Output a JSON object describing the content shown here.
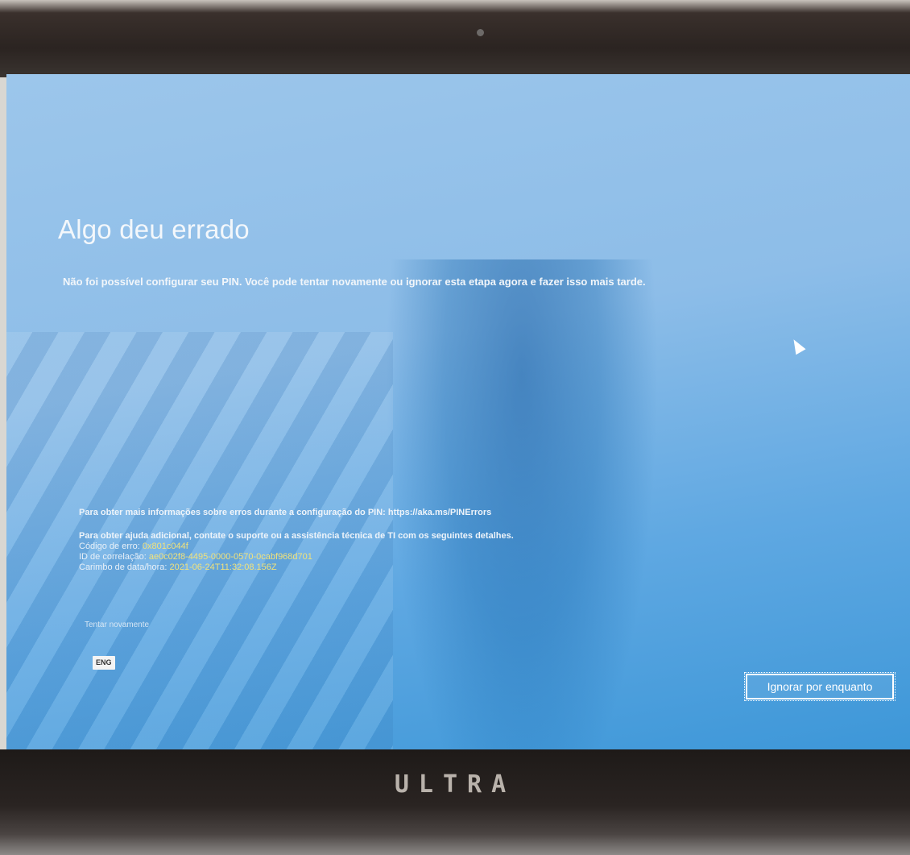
{
  "error_screen": {
    "title": "Algo deu errado",
    "message": "Não foi possível configurar seu PIN. Você pode tentar novamente ou ignorar esta etapa agora e fazer isso mais tarde.",
    "more_info": "Para obter mais informações sobre erros durante a configuração do PIN: https://aka.ms/PINErrors",
    "help_text": "Para obter ajuda adicional, contate o suporte ou a assistência técnica de TI com os seguintes detalhes.",
    "details": [
      {
        "label": "Código de erro:",
        "value": "0x801c044f"
      },
      {
        "label": "ID de correlação:",
        "value": "ae0c02f8-4495-0000-0570-0cabf968d701"
      },
      {
        "label": "Carimbo de data/hora:",
        "value": "2021-06-24T11:32:08.156Z"
      }
    ],
    "retry_label": "Tentar novamente",
    "skip_label": "Ignorar por enquanto",
    "ime_label": "ENG"
  },
  "device": {
    "brand": "ULTRA"
  },
  "colors": {
    "screen_bg": "#8dbde8",
    "detail_value": "#f2e27a",
    "text": "#f2f6fa"
  },
  "icons": {
    "cursor": "mouse-pointer-icon",
    "camera": "webcam-icon"
  }
}
